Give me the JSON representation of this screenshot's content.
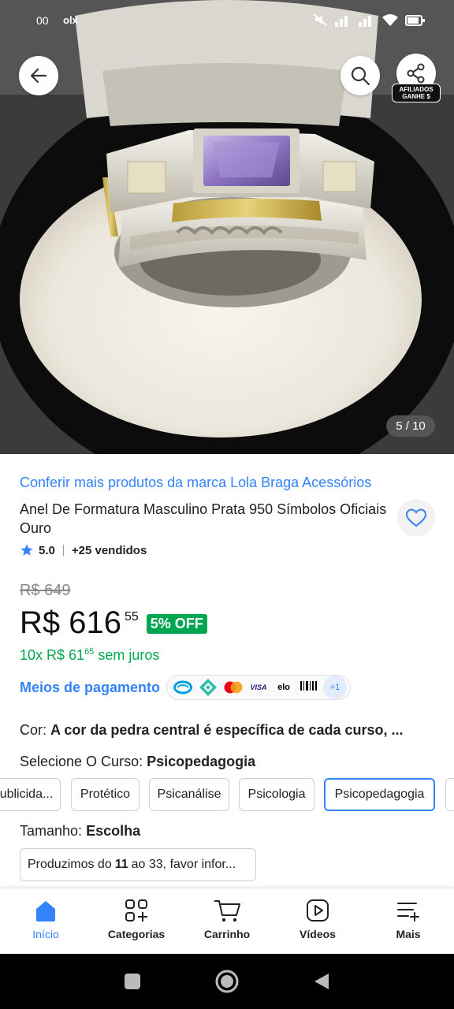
{
  "status_bar": {
    "time": "00",
    "app_badge": "olx"
  },
  "hero": {
    "image_counter": "5 / 10",
    "affiliate_badge_line1": "AFILIADOS",
    "affiliate_badge_line2": "GANHE $"
  },
  "product": {
    "brand_link": "Conferir mais produtos da marca Lola Braga Acessórios",
    "title": "Anel De Formatura Masculino Prata 950 Símbolos Oficiais Ouro",
    "rating": "5.0",
    "sold": "+25 vendidos",
    "old_price": "R$ 649",
    "price": "R$ 616",
    "price_cents": "55",
    "discount": "5% OFF",
    "installments_prefix": "10x R$ 61",
    "installments_cents": "65",
    "installments_suffix": " sem juros",
    "payment_link": "Meios de pagamento",
    "payment_icons": [
      "mercado-pago-icon",
      "pix-icon",
      "mastercard-icon",
      "visa-icon",
      "elo-icon",
      "boleto-icon"
    ],
    "payment_visa": "VISA",
    "payment_elo": "elo",
    "payment_more": "+1"
  },
  "variations": {
    "color_label": "Cor:",
    "color_value": "A cor da pedra central é específica de cada curso, ...",
    "course_label": "Selecione O Curso:",
    "course_value": "Psicopedagogia",
    "courses": [
      "ublicida...",
      "Protético",
      "Psicanálise",
      "Psicologia",
      "Psicopedagogia"
    ],
    "selected_course": "Psicopedagogia",
    "size_label": "Tamanho:",
    "size_value": "Escolha",
    "size_select_prefix": "Produzimos do",
    "size_select_bold": "11",
    "size_select_suffix": "ao 33, favor infor..."
  },
  "tabbar": {
    "tabs": [
      {
        "label": "Início",
        "icon": "home-icon",
        "active": true
      },
      {
        "label": "Categorias",
        "icon": "categories-icon",
        "active": false
      },
      {
        "label": "Carrinho",
        "icon": "cart-icon",
        "active": false
      },
      {
        "label": "Vídeos",
        "icon": "video-icon",
        "active": false
      },
      {
        "label": "Mais",
        "icon": "more-icon",
        "active": false
      }
    ]
  },
  "colors": {
    "accent_blue": "#3483fa",
    "success_green": "#00a650"
  }
}
